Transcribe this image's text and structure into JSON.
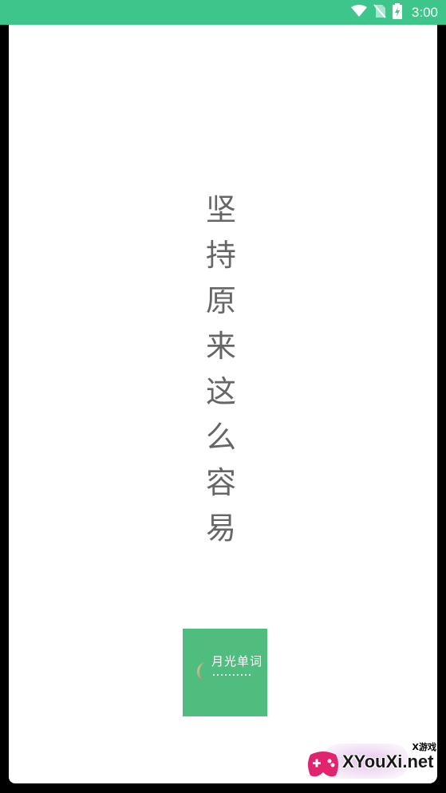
{
  "status_bar": {
    "time": "3:00",
    "icons": [
      "wifi-icon",
      "no-sim-icon",
      "battery-charging-icon"
    ],
    "color": "#3ec58b"
  },
  "slogan": {
    "characters": [
      "坚",
      "持",
      "原",
      "来",
      "这",
      "么",
      "容",
      "易"
    ],
    "color": "#666666"
  },
  "app_logo": {
    "name": "月光单词",
    "background": "#4fbd7e"
  },
  "watermark": {
    "tag": "X游戏",
    "site": "XYouXi.net"
  }
}
